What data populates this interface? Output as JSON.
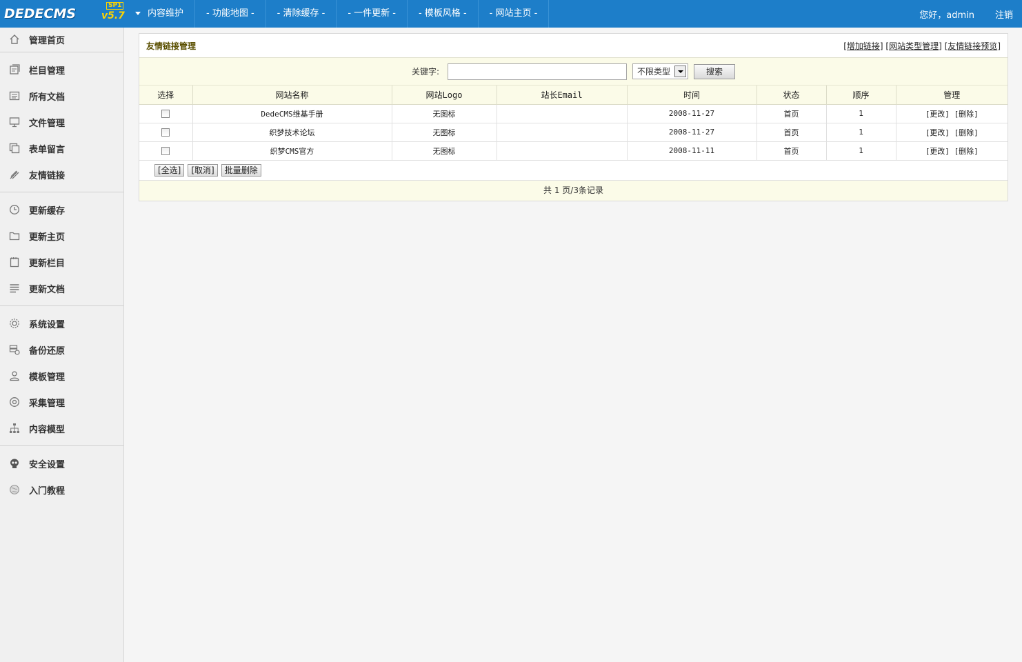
{
  "brand": {
    "logo_text": "DEDECMS",
    "version": "v5.7",
    "edition": "SP1"
  },
  "topnav": {
    "items": [
      "内容维护",
      "- 功能地图 -",
      "- 清除缓存 -",
      "- 一件更新 -",
      "- 模板风格 -",
      "- 网站主页 -"
    ],
    "greeting": "您好，admin",
    "logout": "注销"
  },
  "sidebar": {
    "groups": [
      [
        {
          "label": "管理首页",
          "icon": "home-icon"
        }
      ],
      [
        {
          "label": "栏目管理",
          "icon": "columns-icon"
        },
        {
          "label": "所有文档",
          "icon": "documents-icon"
        },
        {
          "label": "文件管理",
          "icon": "monitor-icon"
        },
        {
          "label": "表单留言",
          "icon": "form-icon"
        },
        {
          "label": "友情链接",
          "icon": "link-icon"
        }
      ],
      [
        {
          "label": "更新缓存",
          "icon": "clock-icon"
        },
        {
          "label": "更新主页",
          "icon": "folder-icon"
        },
        {
          "label": "更新栏目",
          "icon": "notepad-icon"
        },
        {
          "label": "更新文档",
          "icon": "lines-icon"
        }
      ],
      [
        {
          "label": "系统设置",
          "icon": "gear-icon"
        },
        {
          "label": "备份还原",
          "icon": "database-icon"
        },
        {
          "label": "模板管理",
          "icon": "user-icon"
        },
        {
          "label": "采集管理",
          "icon": "collect-icon"
        },
        {
          "label": "内容模型",
          "icon": "sitemap-icon"
        }
      ],
      [
        {
          "label": "安全设置",
          "icon": "skull-icon"
        },
        {
          "label": "入门教程",
          "icon": "globe-icon"
        }
      ]
    ]
  },
  "panel": {
    "title": "友情链接管理",
    "links": [
      "增加链接",
      "网站类型管理",
      "友情链接预览"
    ],
    "search": {
      "label": "关键字:",
      "value": "",
      "type_selected": "不限类型",
      "button": "搜索"
    },
    "columns": [
      "选择",
      "网站名称",
      "网站Logo",
      "站长Email",
      "时间",
      "状态",
      "顺序",
      "管理"
    ],
    "rows": [
      {
        "name": "DedeCMS维基手册",
        "logo": "无图标",
        "email": "",
        "time": "2008-11-27",
        "status": "首页",
        "order": "1",
        "ops": "[更改] [删除]"
      },
      {
        "name": "织梦技术论坛",
        "logo": "无图标",
        "email": "",
        "time": "2008-11-27",
        "status": "首页",
        "order": "1",
        "ops": "[更改] [删除]"
      },
      {
        "name": "织梦CMS官方",
        "logo": "无图标",
        "email": "",
        "time": "2008-11-11",
        "status": "首页",
        "order": "1",
        "ops": "[更改] [删除]"
      }
    ],
    "actions": [
      "[全选]",
      "[取消]",
      "批量删除"
    ],
    "pager": "共 1 页/3条记录"
  },
  "colors": {
    "topbar": "#1d7ec9",
    "sidebar": "#f0f0f0",
    "panel_tint": "#fbfbe8",
    "version": "#ffd400"
  }
}
